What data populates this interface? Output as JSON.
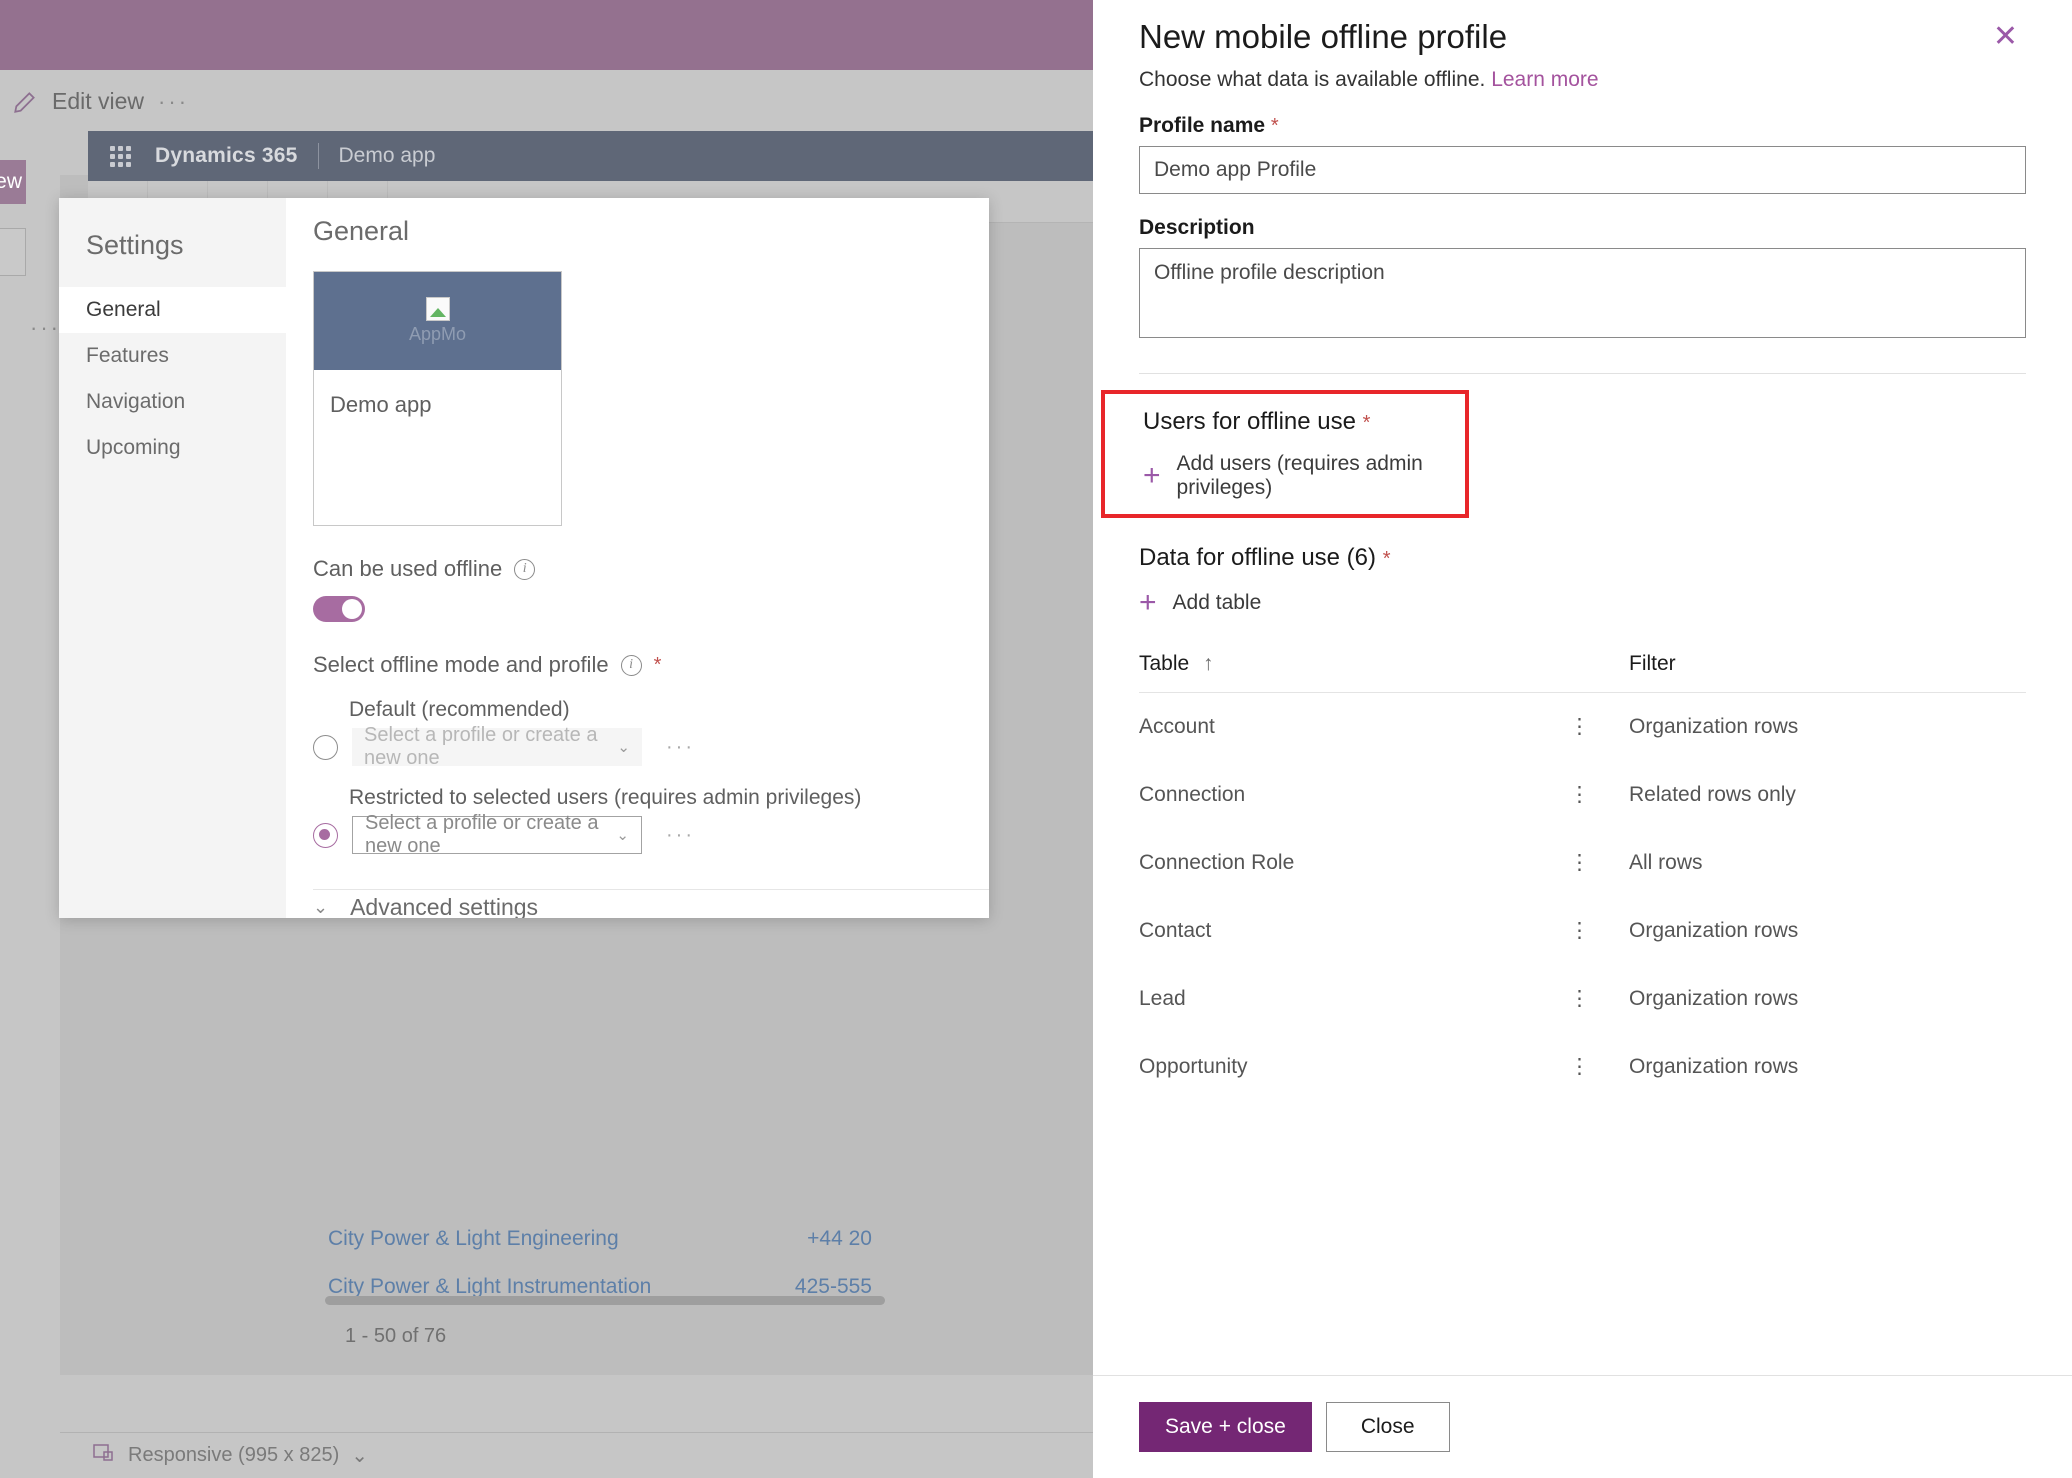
{
  "background": {
    "edit_view_label": "Edit view",
    "overflow_label": "···",
    "new_button_label": "New",
    "left_overflow_label": "···",
    "app_bar": {
      "product_name": "Dynamics 365",
      "app_name": "Demo app"
    },
    "grid_rows": [
      {
        "name": "City Power & Light Engineering",
        "phone": "+44 20"
      },
      {
        "name": "City Power & Light Instrumentation",
        "phone": "425-555"
      }
    ],
    "pager_text": "1 - 50 of 76",
    "status_bar": {
      "icon": "responsive-layout-icon",
      "label": "Responsive (995 x 825)",
      "chevron": "⌄"
    }
  },
  "settings_dialog": {
    "nav_title": "Settings",
    "nav_items": [
      {
        "label": "General",
        "active": true
      },
      {
        "label": "Features",
        "active": false
      },
      {
        "label": "Navigation",
        "active": false
      },
      {
        "label": "Upcoming",
        "active": false
      }
    ],
    "main_title": "General",
    "app_card": {
      "thumb_alt": "AppMo",
      "name": "Demo app"
    },
    "can_be_used_offline": {
      "label": "Can be used offline",
      "info_icon": "info-icon",
      "toggle_state": "on"
    },
    "offline_mode": {
      "label": "Select offline mode and profile",
      "info_icon": "info-icon",
      "required_marker": "*",
      "options": [
        {
          "caption": "Default (recommended)",
          "selected": false,
          "combo_placeholder": "Select a profile or create a new one",
          "chevron": "⌄",
          "overflow": "···",
          "disabled": true
        },
        {
          "caption": "Restricted to selected users (requires admin privileges)",
          "selected": true,
          "combo_placeholder": "Select a profile or create a new one",
          "chevron": "⌄",
          "overflow": "···",
          "disabled": false
        }
      ]
    },
    "advanced_settings": {
      "label": "Advanced settings",
      "chevron": "⌄"
    }
  },
  "panel": {
    "title": "New mobile offline profile",
    "close_icon": "✕",
    "subtitle_text": "Choose what data is available offline.",
    "subtitle_link": "Learn more",
    "profile_name": {
      "label": "Profile name",
      "required_marker": "*",
      "value": "Demo app Profile"
    },
    "description": {
      "label": "Description",
      "value": "Offline profile description"
    },
    "users_section": {
      "title": "Users for offline use",
      "required_marker": "*",
      "add_label": "Add users (requires admin privileges)",
      "plus_icon": "plus-icon",
      "highlight_color": "#e8262a"
    },
    "data_section": {
      "title": "Data for offline use (6)",
      "required_marker": "*",
      "add_label": "Add table",
      "plus_icon": "plus-icon"
    },
    "table": {
      "columns": [
        "Table",
        "Filter"
      ],
      "sort_column": "Table",
      "sort_direction": "↑",
      "kebab_icon": "⋮",
      "rows": [
        {
          "table": "Account",
          "filter": "Organization rows"
        },
        {
          "table": "Connection",
          "filter": "Related rows only"
        },
        {
          "table": "Connection Role",
          "filter": "All rows"
        },
        {
          "table": "Contact",
          "filter": "Organization rows"
        },
        {
          "table": "Lead",
          "filter": "Organization rows"
        },
        {
          "table": "Opportunity",
          "filter": "Organization rows"
        }
      ]
    },
    "footer": {
      "save_label": "Save + close",
      "close_label": "Close"
    }
  },
  "colors": {
    "accent_purple": "#9b59a8",
    "primary_button": "#742774",
    "toggle_on": "#a76ca1",
    "highlight_red": "#e8262a",
    "app_bar": "#5f6777"
  }
}
